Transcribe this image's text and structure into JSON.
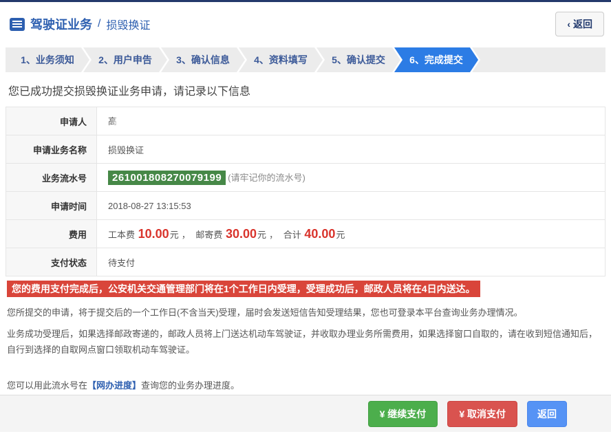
{
  "header": {
    "title": "驾驶证业务",
    "separator": "/",
    "subtitle": "损毁换证",
    "back_button": {
      "icon_glyph": "‹",
      "label": "返回"
    }
  },
  "steps": {
    "items": [
      {
        "label": "1、业务须知",
        "active": false
      },
      {
        "label": "2、用户申告",
        "active": false
      },
      {
        "label": "3、确认信息",
        "active": false
      },
      {
        "label": "4、资料填写",
        "active": false
      },
      {
        "label": "5、确认提交",
        "active": false
      },
      {
        "label": "6、完成提交",
        "active": true
      }
    ],
    "active_color": "#2c7ce5"
  },
  "main": {
    "success_message": "您已成功提交损毁换证业务申请，请记录以下信息",
    "info_table": {
      "applicant": {
        "label": "申请人",
        "value": "高"
      },
      "business_name": {
        "label": "申请业务名称",
        "value": "损毁换证"
      },
      "serial": {
        "label": "业务流水号",
        "number": "261001808270079199",
        "note": "(请牢记你的流水号)",
        "badge_color": "#468847"
      },
      "apply_time": {
        "label": "申请时间",
        "value": "2018-08-27 13:15:53"
      },
      "fee": {
        "label": "费用",
        "item1_label": "工本费",
        "item1_value": "10.00",
        "item2_label": "邮寄费",
        "item2_value": "30.00",
        "total_label": "合计",
        "total_value": "40.00",
        "unit": "元",
        "comma": "，",
        "amount_color": "#d9342c"
      },
      "pay_status": {
        "label": "支付状态",
        "value": "待支付"
      }
    },
    "warning": "您的费用支付完成后，公安机关交通管理部门将在1个工作日内受理，受理成功后，邮政人员将在4日内送达。",
    "paragraphs": {
      "p1": "您所提交的申请，将于提交后的一个工作日(不含当天)受理，届时会发送短信告知受理结果，您也可登录本平台查询业务办理情况。",
      "p2": "业务成功受理后，如果选择邮政寄递的，邮政人员将上门送达机动车驾驶证，并收取办理业务所需费用，如果选择窗口自取的，请在收到短信通知后，自行到选择的自取网点窗口领取机动车驾驶证。",
      "p3_prefix": "您可以用此流水号在",
      "p3_link": "【网办进度】",
      "p3_suffix": "查询您的业务办理进度。"
    }
  },
  "footer": {
    "continue_pay_label": "¥ 继续支付",
    "cancel_pay_label": "¥ 取消支付",
    "back_label": "返回",
    "continue_color": "#4cae4c",
    "cancel_color": "#d9534f",
    "back_color": "#5693f5"
  }
}
